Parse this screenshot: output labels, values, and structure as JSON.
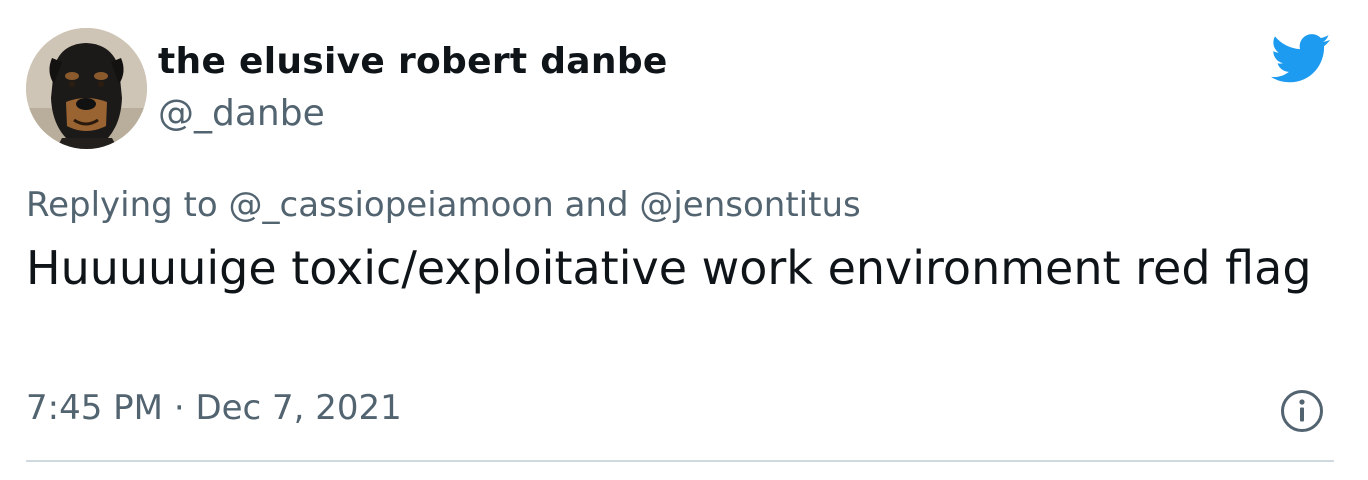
{
  "author": {
    "display_name": "the elusive robert danbe",
    "handle": "@_danbe",
    "avatar_icon": "rottweiler-dog-avatar"
  },
  "platform_icon": "twitter-bird-icon",
  "reply": {
    "prefix": "Replying to",
    "mention_1": "@_cassiopeiamoon",
    "joiner": "and",
    "mention_2": "@jensontitus"
  },
  "tweet_text": "Huuuuuige toxic/exploitative work environment red flag",
  "timestamp": {
    "time": "7:45 PM",
    "separator": "·",
    "date": "Dec 7, 2021"
  },
  "info_icon": "info-circle-icon",
  "colors": {
    "text_primary": "#0f1419",
    "text_secondary": "#536471",
    "twitter_blue": "#1d9bf0",
    "divider": "#cfd9de"
  }
}
